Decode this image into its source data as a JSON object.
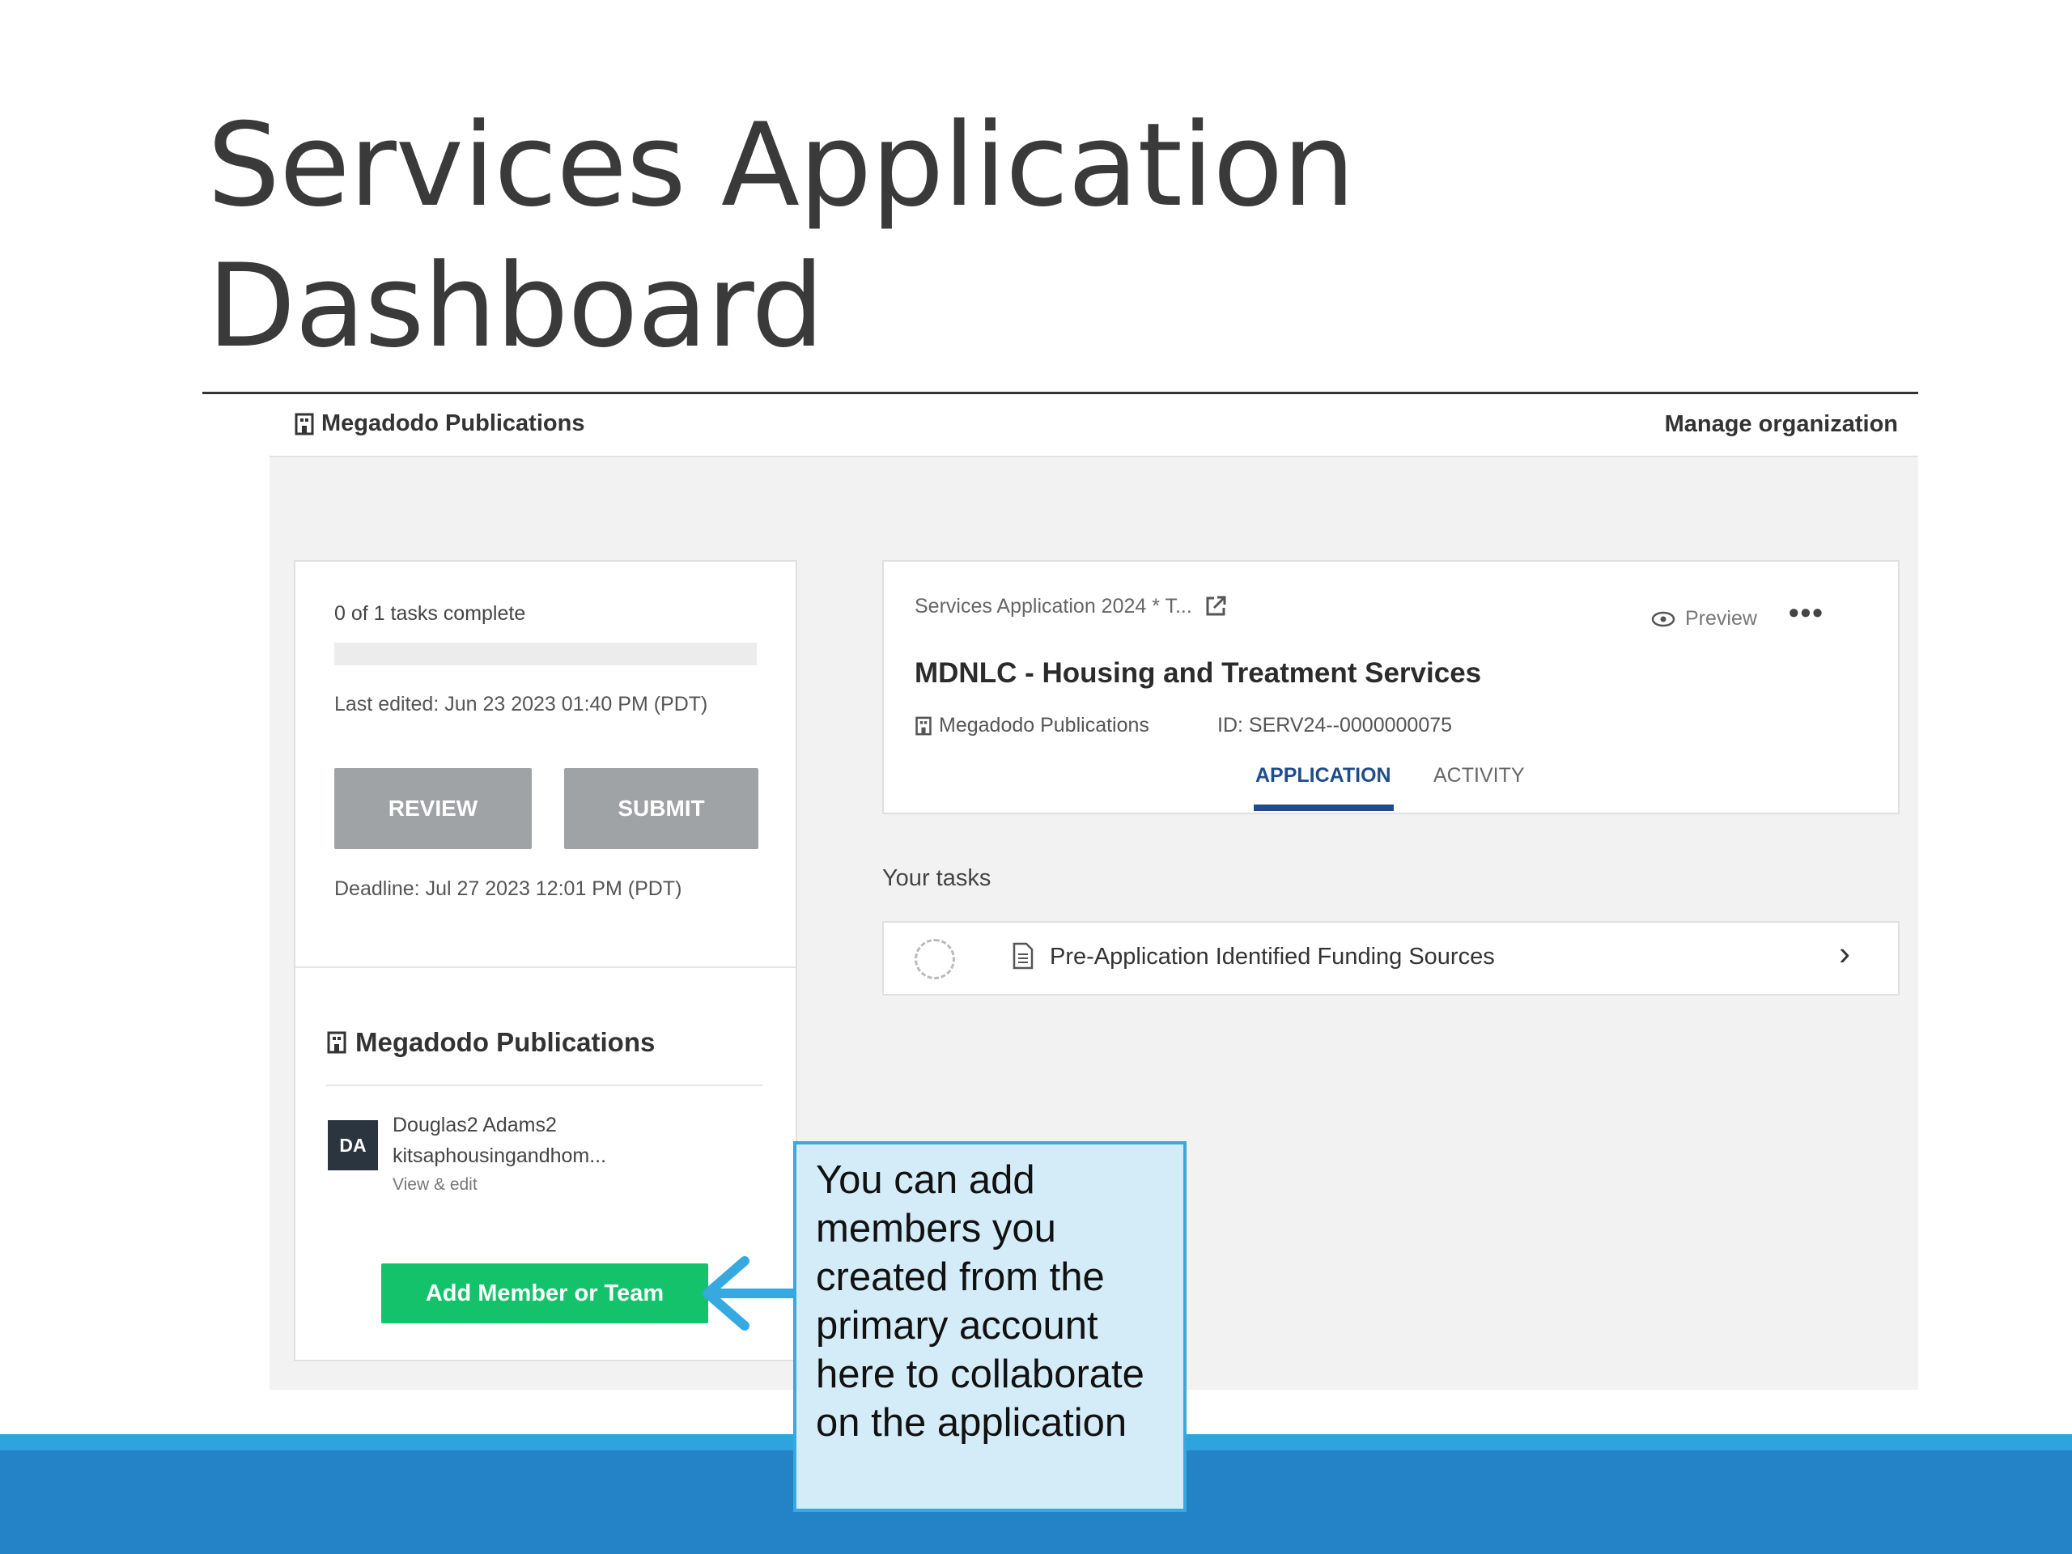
{
  "slide": {
    "title_line1": "Services Application",
    "title_line2": "Dashboard"
  },
  "org_bar": {
    "org_name": "Megadodo Publications",
    "manage_label": "Manage organization"
  },
  "left_panel": {
    "tasks_complete": "0 of 1 tasks complete",
    "progress_fraction": 0,
    "last_edited": "Last edited: Jun 23 2023 01:40 PM (PDT)",
    "review_label": "REVIEW",
    "submit_label": "SUBMIT",
    "deadline": "Deadline: Jul 27 2023 12:01 PM (PDT)",
    "org_title": "Megadodo Publications",
    "member": {
      "initials": "DA",
      "name": "Douglas2 Adams2",
      "email": "kitsaphousingandhom...",
      "edit_label": "View & edit"
    },
    "add_member_label": "Add Member or Team"
  },
  "application": {
    "name": "Services Application 2024 * T...",
    "preview_label": "Preview",
    "more_label": "•••",
    "title": "MDNLC - Housing and Treatment Services",
    "org": "Megadodo Publications",
    "id_label": "ID:",
    "id_value": "SERV24--0000000075",
    "tabs": [
      {
        "label": "APPLICATION",
        "active": true
      },
      {
        "label": "ACTIVITY",
        "active": false
      }
    ]
  },
  "tasks": {
    "heading": "Your tasks",
    "items": [
      {
        "label": "Pre-Application Identified Funding Sources"
      }
    ]
  },
  "callout": {
    "lines": [
      "You can add",
      "members you",
      "created from the",
      "primary account",
      "here to collaborate",
      "on the application"
    ]
  },
  "colors": {
    "accent_blue": "#1f4d8a",
    "add_button_green": "#13c26a",
    "band_blue": "#2482c7",
    "callout_fill": "#d3ecf8",
    "callout_border": "#36a9e1"
  }
}
